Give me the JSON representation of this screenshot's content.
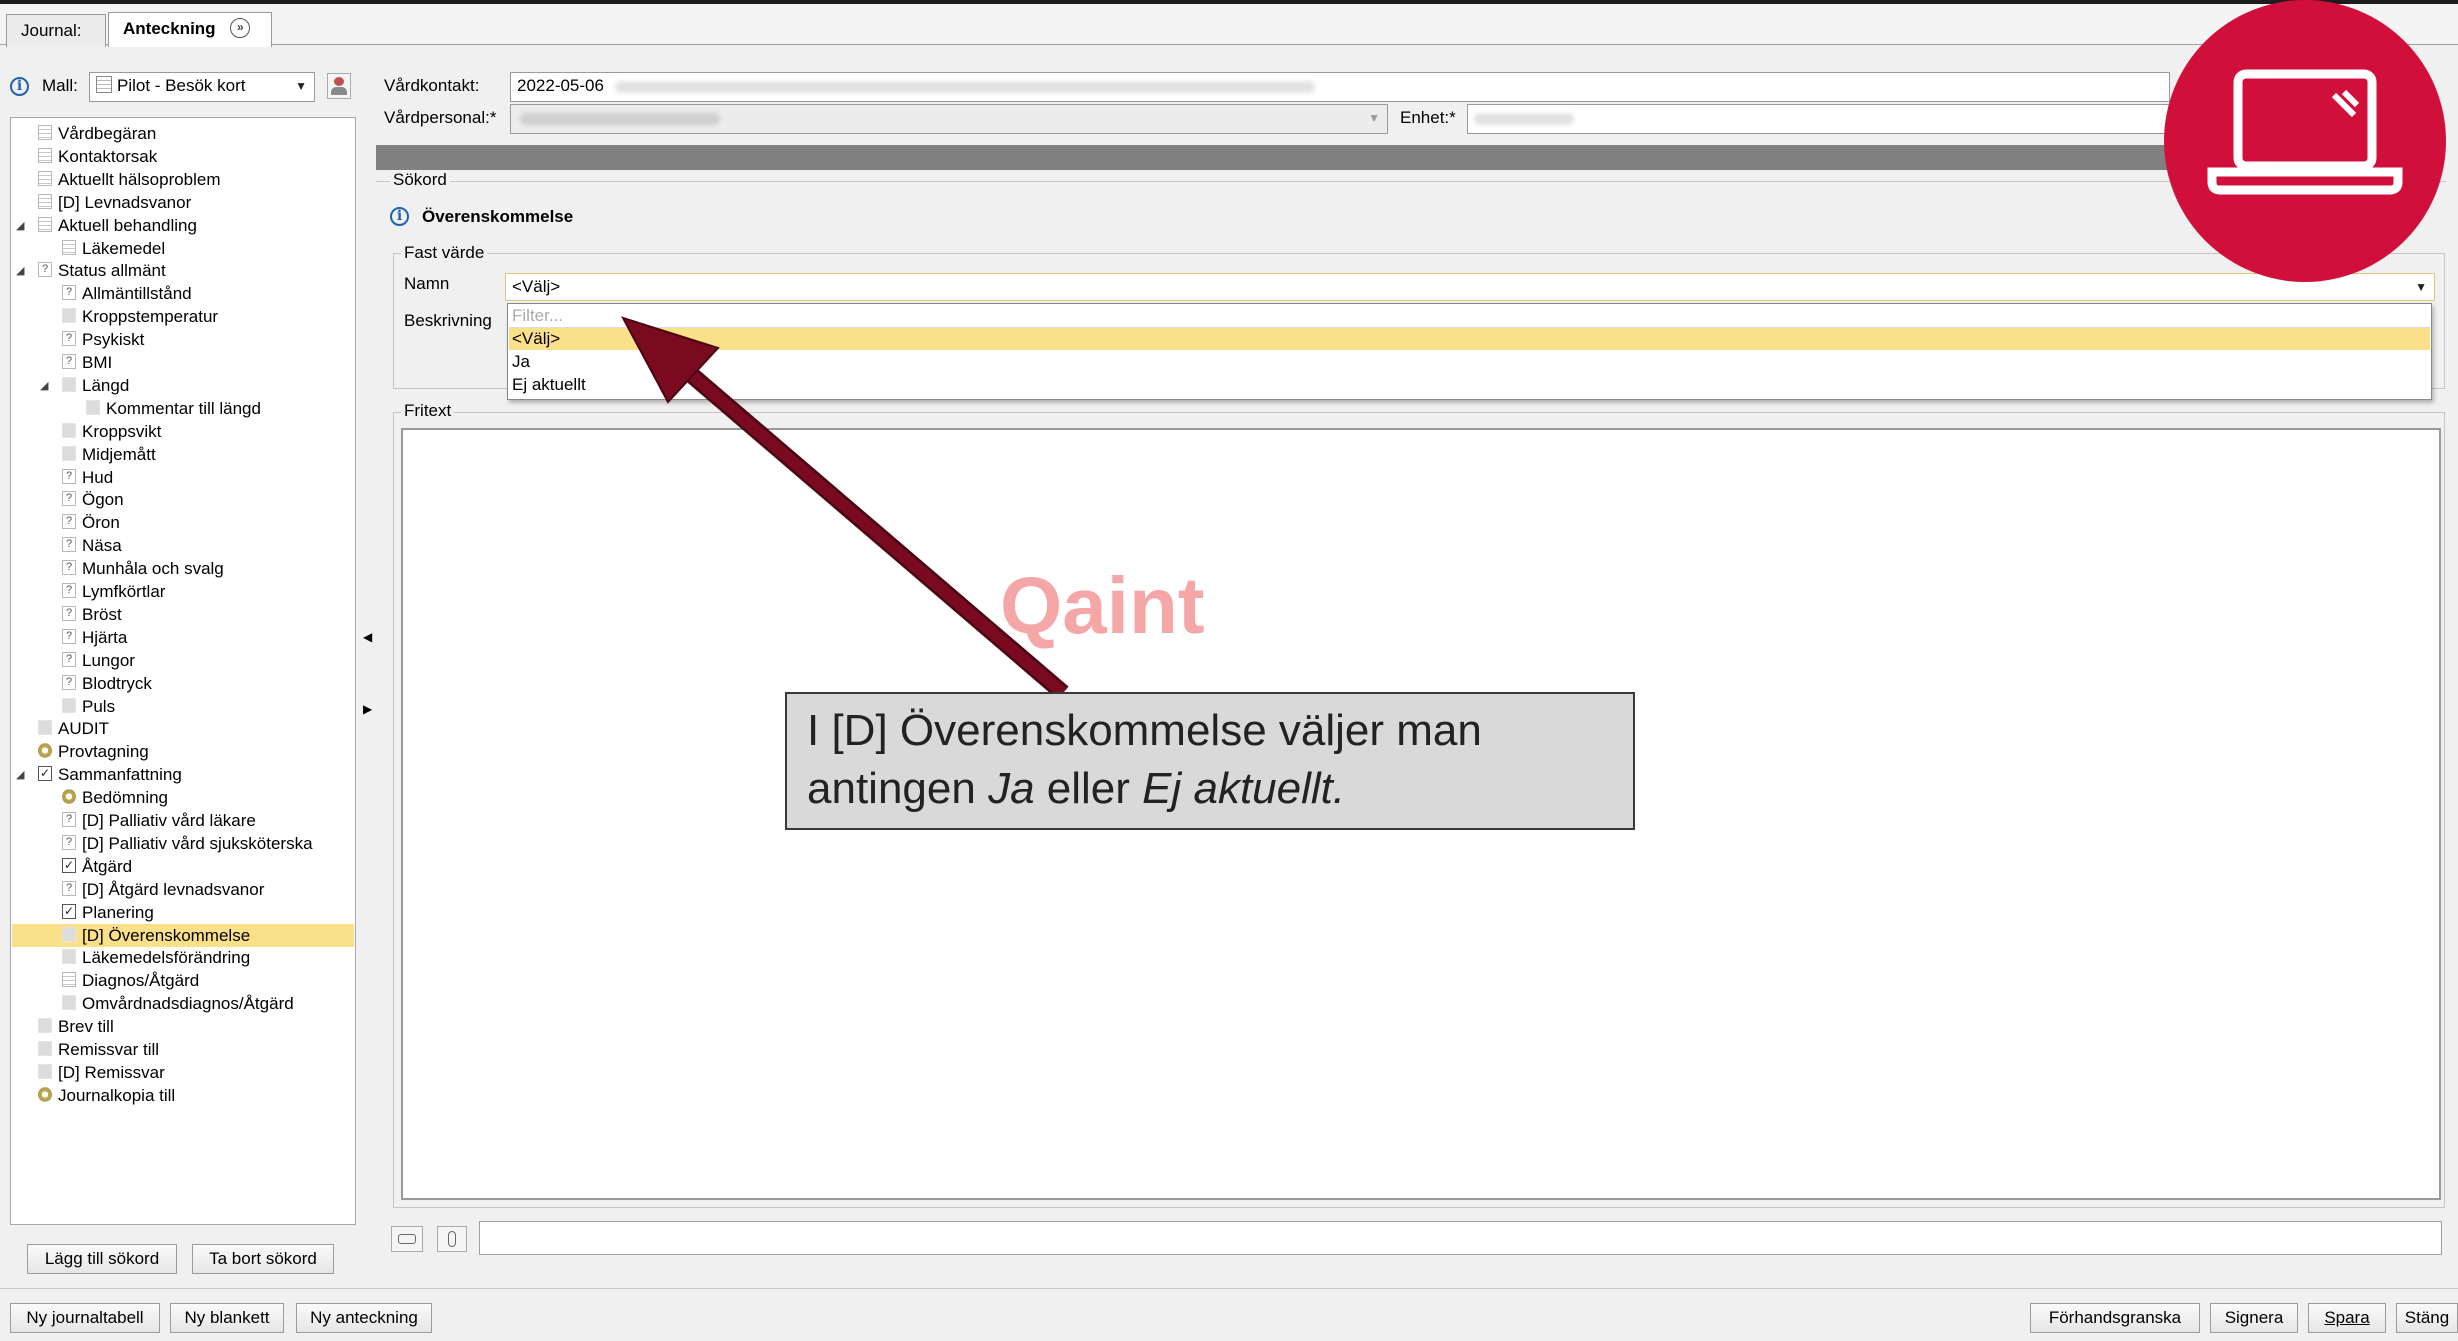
{
  "tabs": {
    "journal": "Journal:",
    "anteckning": "Anteckning"
  },
  "header": {
    "mall_label": "Mall:",
    "mall_value": "Pilot - Besök kort",
    "vardkontakt_label": "Vårdkontakt:",
    "vardkontakt_value": "2022-05-06",
    "vardpersonal_label": "Vårdpersonal:*",
    "enhet_label": "Enhet:*"
  },
  "tree": {
    "items": [
      {
        "label": "Vårdbegäran",
        "icon": "doc-icon"
      },
      {
        "label": "Kontaktorsak",
        "icon": "doc-icon"
      },
      {
        "label": "Aktuellt hälsoproblem",
        "icon": "doc-icon"
      },
      {
        "label": "[D] Levnadsvanor",
        "icon": "doc-icon"
      },
      {
        "label": "Aktuell behandling",
        "icon": "doc-icon"
      },
      {
        "label": "Läkemedel",
        "icon": "doc-icon"
      },
      {
        "label": "Status allmänt",
        "icon": "question-doc-icon"
      },
      {
        "label": "Allmäntillstånd",
        "icon": "question-icon"
      },
      {
        "label": "Kroppstemperatur",
        "icon": "plain-icon"
      },
      {
        "label": "Psykiskt",
        "icon": "question-icon"
      },
      {
        "label": "BMI",
        "icon": "question-icon"
      },
      {
        "label": "Längd",
        "icon": "plain-icon"
      },
      {
        "label": "Kommentar till längd",
        "icon": "plain-icon"
      },
      {
        "label": "Kroppsvikt",
        "icon": "plain-icon"
      },
      {
        "label": "Midjemått",
        "icon": "plain-icon"
      },
      {
        "label": "Hud",
        "icon": "question-icon"
      },
      {
        "label": "Ögon",
        "icon": "question-icon"
      },
      {
        "label": "Öron",
        "icon": "question-icon"
      },
      {
        "label": "Näsa",
        "icon": "question-icon"
      },
      {
        "label": "Munhåla och svalg",
        "icon": "question-icon"
      },
      {
        "label": "Lymfkörtlar",
        "icon": "question-icon"
      },
      {
        "label": "Bröst",
        "icon": "question-icon"
      },
      {
        "label": "Hjärta",
        "icon": "question-icon"
      },
      {
        "label": "Lungor",
        "icon": "question-icon"
      },
      {
        "label": "Blodtryck",
        "icon": "question-icon"
      },
      {
        "label": "Puls",
        "icon": "plain-icon"
      },
      {
        "label": "AUDIT",
        "icon": "plain-icon"
      },
      {
        "label": "Provtagning",
        "icon": "gear-icon"
      },
      {
        "label": "Sammanfattning",
        "icon": "check-doc-icon"
      },
      {
        "label": "Bedömning",
        "icon": "gear-icon"
      },
      {
        "label": "[D] Palliativ vård läkare",
        "icon": "question-icon"
      },
      {
        "label": "[D] Palliativ vård sjuksköterska",
        "icon": "question-icon"
      },
      {
        "label": "Åtgärd",
        "icon": "checkbox-icon"
      },
      {
        "label": "[D] Åtgärd levnadsvanor",
        "icon": "question-icon"
      },
      {
        "label": "Planering",
        "icon": "checkbox-icon"
      },
      {
        "label": "[D] Överenskommelse",
        "icon": "plain-icon"
      },
      {
        "label": "Läkemedelsförändring",
        "icon": "plain-icon"
      },
      {
        "label": "Diagnos/Åtgärd",
        "icon": "doc-icon"
      },
      {
        "label": "Omvårdnadsdiagnos/Åtgärd",
        "icon": "plain-icon"
      },
      {
        "label": "Brev till",
        "icon": "plain-icon"
      },
      {
        "label": "Remissvar till",
        "icon": "plain-icon"
      },
      {
        "label": "[D] Remissvar",
        "icon": "plain-icon"
      },
      {
        "label": "Journalkopia till",
        "icon": "gear-icon"
      }
    ],
    "selected": "[D] Överenskommelse"
  },
  "left_buttons": {
    "add": "Lägg till sökord",
    "remove": "Ta bort sökord"
  },
  "main": {
    "sokord_label": "Sökord",
    "term_title": "Överenskommelse",
    "fast_varde_label": "Fast värde",
    "namn_label": "Namn",
    "namn_value": "<Välj>",
    "beskrivning_label": "Beskrivning",
    "fritext_label": "Fritext",
    "dropdown": {
      "filter_placeholder": "Filter...",
      "options": [
        "<Välj>",
        "Ja",
        "Ej aktuellt"
      ],
      "highlighted": "<Välj>"
    }
  },
  "annotation": {
    "watermark": "Qaint",
    "callout_line1": "I [D] Överenskommelse väljer man",
    "callout_line2_a": "antingen ",
    "callout_line2_b": "Ja",
    "callout_line2_c": " eller ",
    "callout_line2_d": "Ej aktuellt.",
    "arrow_color": "#7a0a20",
    "badge_color": "#d0103a",
    "badge_icon": "laptop-icon"
  },
  "bottom_bar": {
    "ny_journaltabell": "Ny journaltabell",
    "ny_blankett": "Ny blankett",
    "ny_anteckning": "Ny anteckning",
    "forhandsgranska": "Förhandsgranska",
    "signera": "Signera",
    "spara": "Spara",
    "stang": "Stäng"
  }
}
